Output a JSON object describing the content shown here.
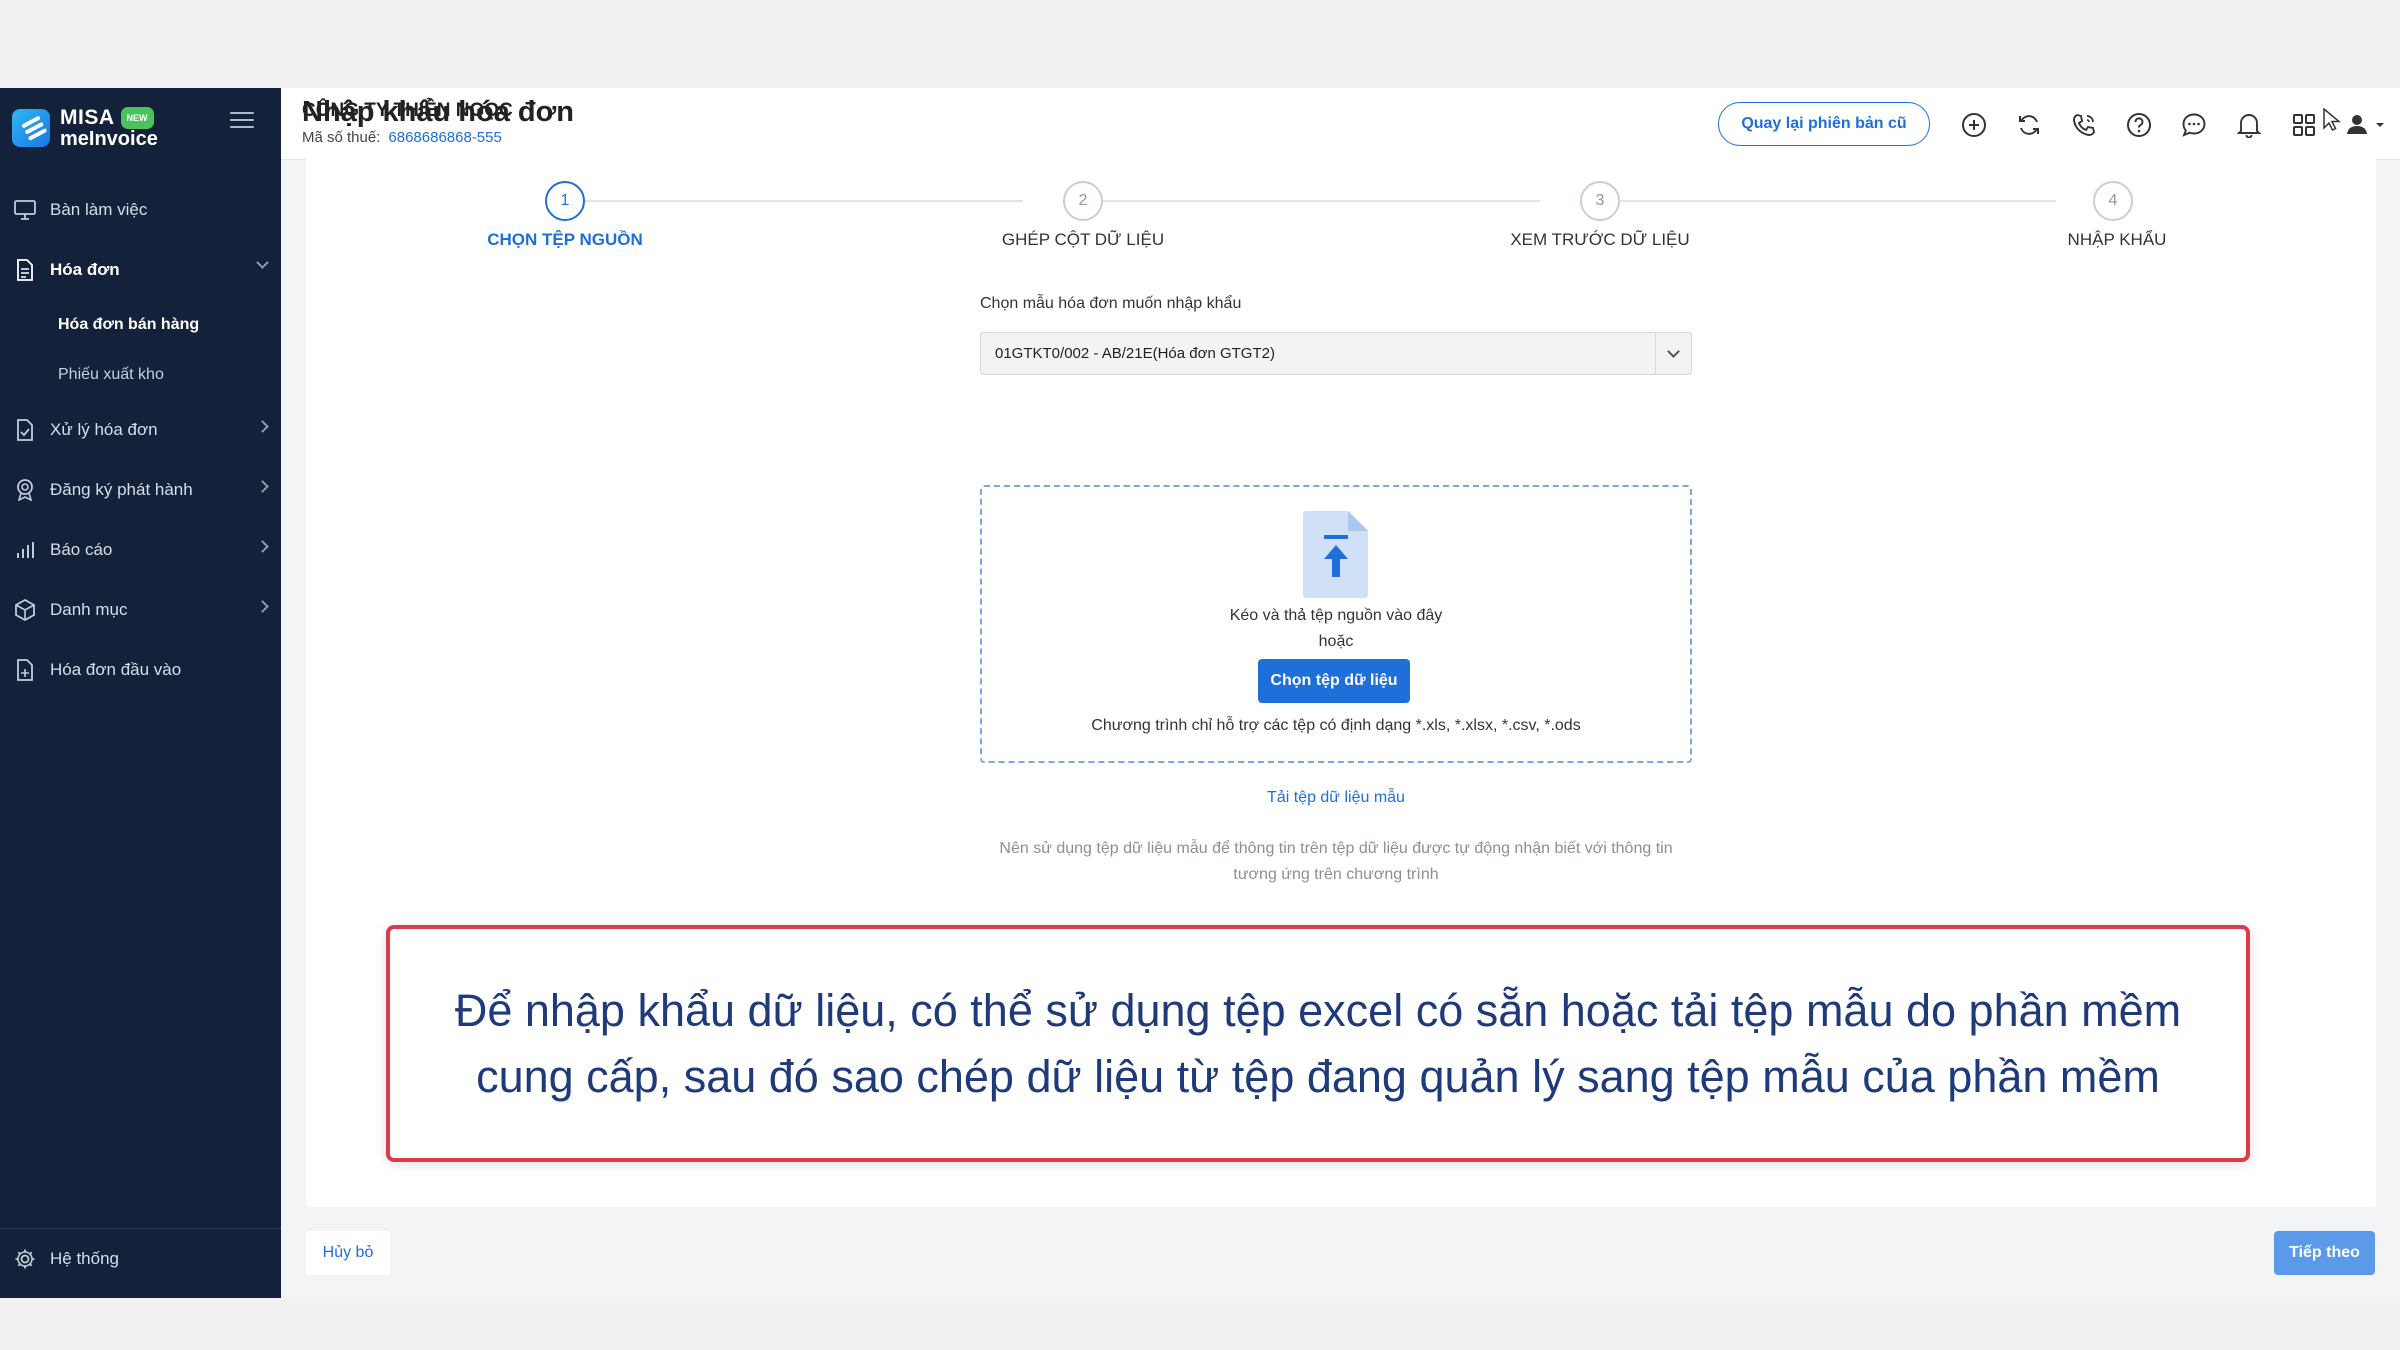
{
  "brand": {
    "name": "MISA",
    "badge": "NEW",
    "sub": "meInvoice"
  },
  "sidebar": {
    "items": [
      {
        "label": "Bàn làm việc",
        "icon": "monitor-icon"
      },
      {
        "label": "Hóa đơn",
        "icon": "document-icon",
        "expanded": true,
        "children": [
          {
            "label": "Hóa đơn bán hàng",
            "active": true
          },
          {
            "label": "Phiếu xuất kho"
          }
        ]
      },
      {
        "label": "Xử lý hóa đơn",
        "icon": "document-check-icon"
      },
      {
        "label": "Đăng ký phát hành",
        "icon": "badge-icon"
      },
      {
        "label": "Báo cáo",
        "icon": "bar-chart-icon"
      },
      {
        "label": "Danh mục",
        "icon": "box-icon"
      },
      {
        "label": "Hóa đơn đầu vào",
        "icon": "document-in-icon"
      }
    ],
    "system": {
      "label": "Hệ thống",
      "icon": "gear-icon"
    }
  },
  "header": {
    "company": "CÔNG TY THIÊN NGỌC",
    "tax_label": "Mã số thuế:",
    "tax_value": "6868686868-555",
    "back_button": "Quay lại phiên bản cũ"
  },
  "page": {
    "title": "Nhập khẩu hóa đơn"
  },
  "steps": [
    {
      "number": "1",
      "label": "CHỌN TỆP NGUỒN",
      "active": true
    },
    {
      "number": "2",
      "label": "GHÉP CỘT DỮ LIỆU"
    },
    {
      "number": "3",
      "label": "XEM TRƯỚC DỮ LIỆU"
    },
    {
      "number": "4",
      "label": "NHẬP KHẨU"
    }
  ],
  "template": {
    "label": "Chọn mẫu hóa đơn muốn nhập khẩu",
    "selected": "01GTKT0/002 - AB/21E(Hóa đơn GTGT2)"
  },
  "dropzone": {
    "line1": "Kéo và thả tệp nguồn vào đây",
    "line2": "hoặc",
    "button": "Chọn tệp dữ liệu",
    "formats": "Chương trình chỉ hỗ trợ các tệp có định dạng *.xls, *.xlsx, *.csv, *.ods"
  },
  "sample_link": "Tải tệp dữ liệu mẫu",
  "hint": {
    "line1": "Nên sử dụng tệp dữ liệu mẫu để thông tin trên tệp dữ liệu được tự động nhận biết với thông tin",
    "line2": "tương ứng trên chương trình"
  },
  "callout": {
    "line1": "Để nhập khẩu dữ liệu, có thể sử dụng tệp excel có sẵn hoặc tải tệp mẫu do phần mềm",
    "line2": "cung cấp, sau đó sao chép dữ liệu từ tệp đang quản lý sang tệp mẫu của phần mềm"
  },
  "footer": {
    "cancel": "Hủy bỏ",
    "next": "Tiếp theo"
  },
  "colors": {
    "sidebar": "#13213a",
    "accent": "#1e6fd9",
    "callout_border": "#dc3b4c"
  }
}
